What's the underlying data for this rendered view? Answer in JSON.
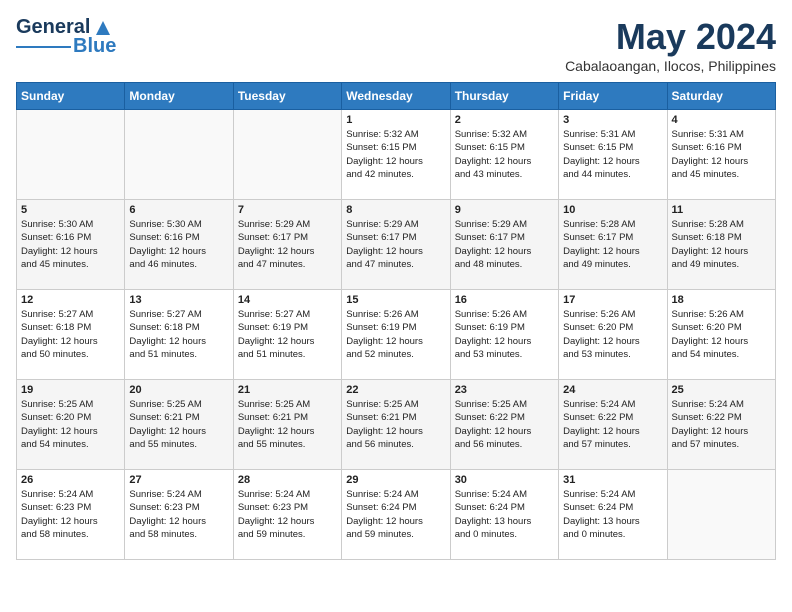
{
  "header": {
    "logo_general": "General",
    "logo_blue": "Blue",
    "month": "May 2024",
    "location": "Cabalaoangan, Ilocos, Philippines"
  },
  "weekdays": [
    "Sunday",
    "Monday",
    "Tuesday",
    "Wednesday",
    "Thursday",
    "Friday",
    "Saturday"
  ],
  "weeks": [
    [
      {
        "day": "",
        "info": ""
      },
      {
        "day": "",
        "info": ""
      },
      {
        "day": "",
        "info": ""
      },
      {
        "day": "1",
        "info": "Sunrise: 5:32 AM\nSunset: 6:15 PM\nDaylight: 12 hours\nand 42 minutes."
      },
      {
        "day": "2",
        "info": "Sunrise: 5:32 AM\nSunset: 6:15 PM\nDaylight: 12 hours\nand 43 minutes."
      },
      {
        "day": "3",
        "info": "Sunrise: 5:31 AM\nSunset: 6:15 PM\nDaylight: 12 hours\nand 44 minutes."
      },
      {
        "day": "4",
        "info": "Sunrise: 5:31 AM\nSunset: 6:16 PM\nDaylight: 12 hours\nand 45 minutes."
      }
    ],
    [
      {
        "day": "5",
        "info": "Sunrise: 5:30 AM\nSunset: 6:16 PM\nDaylight: 12 hours\nand 45 minutes."
      },
      {
        "day": "6",
        "info": "Sunrise: 5:30 AM\nSunset: 6:16 PM\nDaylight: 12 hours\nand 46 minutes."
      },
      {
        "day": "7",
        "info": "Sunrise: 5:29 AM\nSunset: 6:17 PM\nDaylight: 12 hours\nand 47 minutes."
      },
      {
        "day": "8",
        "info": "Sunrise: 5:29 AM\nSunset: 6:17 PM\nDaylight: 12 hours\nand 47 minutes."
      },
      {
        "day": "9",
        "info": "Sunrise: 5:29 AM\nSunset: 6:17 PM\nDaylight: 12 hours\nand 48 minutes."
      },
      {
        "day": "10",
        "info": "Sunrise: 5:28 AM\nSunset: 6:17 PM\nDaylight: 12 hours\nand 49 minutes."
      },
      {
        "day": "11",
        "info": "Sunrise: 5:28 AM\nSunset: 6:18 PM\nDaylight: 12 hours\nand 49 minutes."
      }
    ],
    [
      {
        "day": "12",
        "info": "Sunrise: 5:27 AM\nSunset: 6:18 PM\nDaylight: 12 hours\nand 50 minutes."
      },
      {
        "day": "13",
        "info": "Sunrise: 5:27 AM\nSunset: 6:18 PM\nDaylight: 12 hours\nand 51 minutes."
      },
      {
        "day": "14",
        "info": "Sunrise: 5:27 AM\nSunset: 6:19 PM\nDaylight: 12 hours\nand 51 minutes."
      },
      {
        "day": "15",
        "info": "Sunrise: 5:26 AM\nSunset: 6:19 PM\nDaylight: 12 hours\nand 52 minutes."
      },
      {
        "day": "16",
        "info": "Sunrise: 5:26 AM\nSunset: 6:19 PM\nDaylight: 12 hours\nand 53 minutes."
      },
      {
        "day": "17",
        "info": "Sunrise: 5:26 AM\nSunset: 6:20 PM\nDaylight: 12 hours\nand 53 minutes."
      },
      {
        "day": "18",
        "info": "Sunrise: 5:26 AM\nSunset: 6:20 PM\nDaylight: 12 hours\nand 54 minutes."
      }
    ],
    [
      {
        "day": "19",
        "info": "Sunrise: 5:25 AM\nSunset: 6:20 PM\nDaylight: 12 hours\nand 54 minutes."
      },
      {
        "day": "20",
        "info": "Sunrise: 5:25 AM\nSunset: 6:21 PM\nDaylight: 12 hours\nand 55 minutes."
      },
      {
        "day": "21",
        "info": "Sunrise: 5:25 AM\nSunset: 6:21 PM\nDaylight: 12 hours\nand 55 minutes."
      },
      {
        "day": "22",
        "info": "Sunrise: 5:25 AM\nSunset: 6:21 PM\nDaylight: 12 hours\nand 56 minutes."
      },
      {
        "day": "23",
        "info": "Sunrise: 5:25 AM\nSunset: 6:22 PM\nDaylight: 12 hours\nand 56 minutes."
      },
      {
        "day": "24",
        "info": "Sunrise: 5:24 AM\nSunset: 6:22 PM\nDaylight: 12 hours\nand 57 minutes."
      },
      {
        "day": "25",
        "info": "Sunrise: 5:24 AM\nSunset: 6:22 PM\nDaylight: 12 hours\nand 57 minutes."
      }
    ],
    [
      {
        "day": "26",
        "info": "Sunrise: 5:24 AM\nSunset: 6:23 PM\nDaylight: 12 hours\nand 58 minutes."
      },
      {
        "day": "27",
        "info": "Sunrise: 5:24 AM\nSunset: 6:23 PM\nDaylight: 12 hours\nand 58 minutes."
      },
      {
        "day": "28",
        "info": "Sunrise: 5:24 AM\nSunset: 6:23 PM\nDaylight: 12 hours\nand 59 minutes."
      },
      {
        "day": "29",
        "info": "Sunrise: 5:24 AM\nSunset: 6:24 PM\nDaylight: 12 hours\nand 59 minutes."
      },
      {
        "day": "30",
        "info": "Sunrise: 5:24 AM\nSunset: 6:24 PM\nDaylight: 13 hours\nand 0 minutes."
      },
      {
        "day": "31",
        "info": "Sunrise: 5:24 AM\nSunset: 6:24 PM\nDaylight: 13 hours\nand 0 minutes."
      },
      {
        "day": "",
        "info": ""
      }
    ]
  ]
}
